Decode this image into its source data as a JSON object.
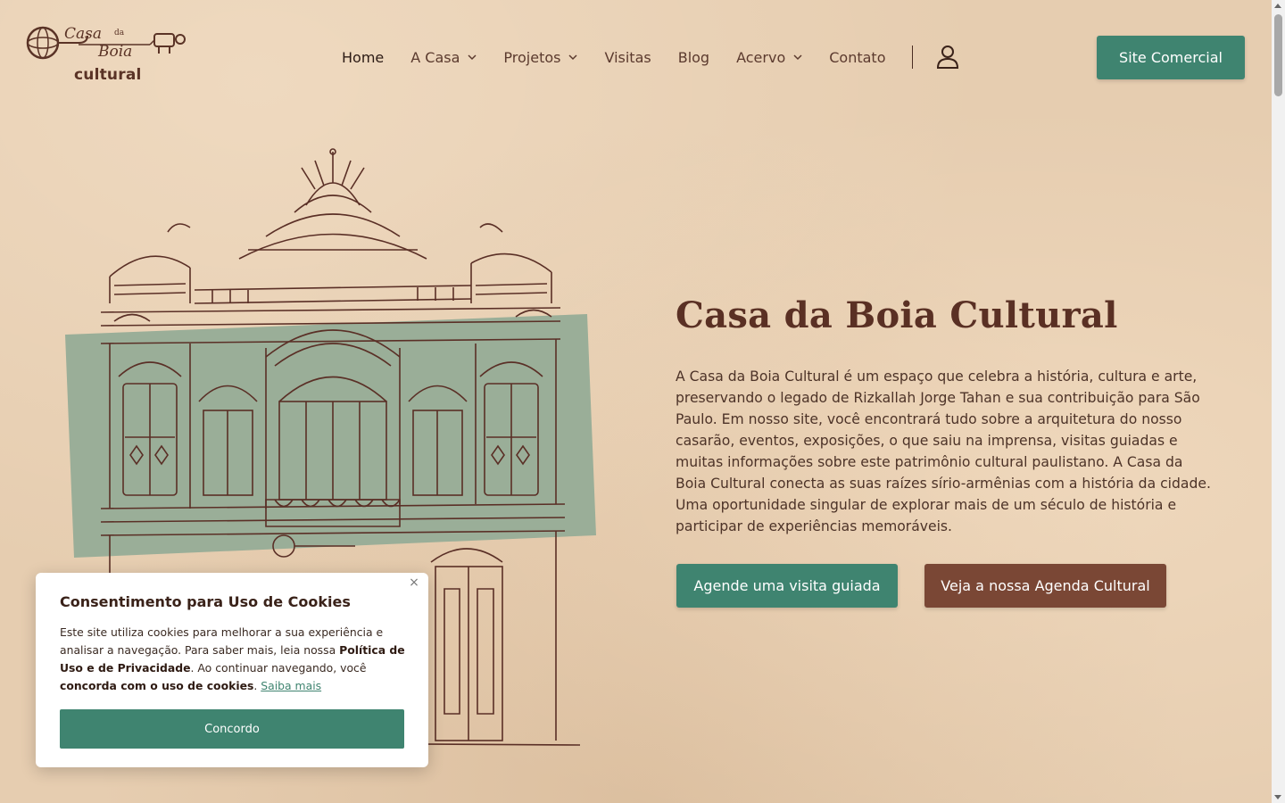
{
  "colors": {
    "background": "#e6cdb0",
    "primary_green": "#3f8470",
    "brown_button": "#7a4735",
    "title_brown": "#5a3024",
    "sage_panel": "#9aae98"
  },
  "logo": {
    "script_casa": "Casa",
    "script_da": "da",
    "script_boia": "Boia",
    "word": "cultural",
    "icon": "faucet-globe-logo"
  },
  "nav": {
    "items": [
      {
        "label": "Home",
        "active": true,
        "dropdown": false
      },
      {
        "label": "A Casa",
        "active": false,
        "dropdown": true
      },
      {
        "label": "Projetos",
        "active": false,
        "dropdown": true
      },
      {
        "label": "Visitas",
        "active": false,
        "dropdown": false
      },
      {
        "label": "Blog",
        "active": false,
        "dropdown": false
      },
      {
        "label": "Acervo",
        "active": false,
        "dropdown": true
      },
      {
        "label": "Contato",
        "active": false,
        "dropdown": false
      }
    ],
    "user_icon": "user-icon",
    "commercial_button": "Site Comercial"
  },
  "hero": {
    "title": "Casa da Boia Cultural",
    "description": "A Casa da Boia Cultural é um espaço que celebra a história, cultura e arte, preservando o legado de Rizkallah Jorge Tahan e sua contribuição para São Paulo. Em nosso site, você encontrará tudo sobre a arquitetura do nosso casarão, eventos, exposições, o que saiu na imprensa, visitas guiadas e muitas informações sobre este patrimônio cultural paulistano. A Casa da Boia Cultural conecta as suas raízes sírio-armênias com a história da cidade. Uma oportunidade singular de explorar mais de um século de história e participar de experiências memoráveis.",
    "button_visit": "Agende uma visita guiada",
    "button_agenda": "Veja a nossa Agenda Cultural",
    "illustration": "building-facade-illustration"
  },
  "cookie": {
    "title": "Consentimento para Uso de Cookies",
    "text_1": "Este site utiliza cookies para melhorar a sua experiência e analisar a navegação. Para saber mais, leia nossa ",
    "text_bold_1": "Política de Uso e de Privacidade",
    "text_2": ". Ao continuar navegando, você ",
    "text_bold_2": "concorda com o uso de cookies",
    "text_3": ". ",
    "link": "Saiba mais",
    "button": "Concordo",
    "close": "×"
  }
}
